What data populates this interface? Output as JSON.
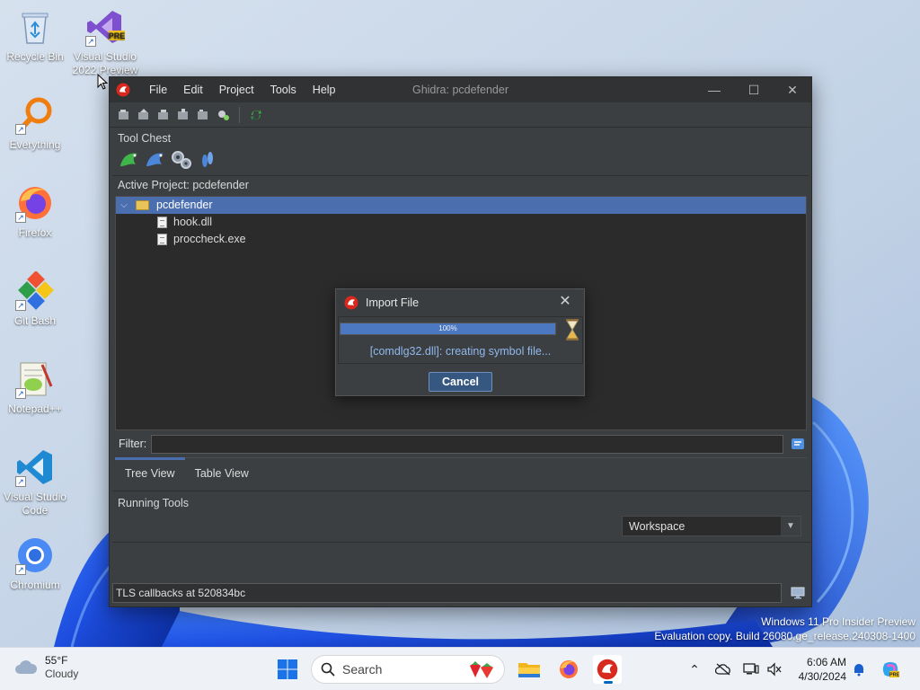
{
  "desktop": {
    "icons": [
      {
        "label": "Recycle Bin"
      },
      {
        "label": "Visual Studio 2022 Preview",
        "badge": "PRE"
      },
      {
        "label": "Everything"
      },
      {
        "label": "Firefox"
      },
      {
        "label": "Git Bash"
      },
      {
        "label": "Notepad++"
      },
      {
        "label": "Visual Studio Code"
      },
      {
        "label": "Chromium"
      }
    ],
    "watermark": {
      "line1": "Windows 11 Pro Insider Preview",
      "line2": "Evaluation copy. Build 26080.ge_release.240308-1400"
    }
  },
  "ghidra": {
    "title": "Ghidra: pcdefender",
    "menu": [
      "File",
      "Edit",
      "Project",
      "Tools",
      "Help"
    ],
    "window_controls": {
      "minimize": "—",
      "maximize": "☐",
      "close": "✕"
    },
    "tool_chest_label": "Tool Chest",
    "active_project_label": "Active Project: pcdefender",
    "tree": {
      "root": "pcdefender",
      "children": [
        "hook.dll",
        "proccheck.exe"
      ]
    },
    "filter_label": "Filter:",
    "filter_value": "",
    "tabs": [
      "Tree View",
      "Table View"
    ],
    "running_tools_label": "Running Tools",
    "workspace_value": "Workspace",
    "status_text": "TLS callbacks at 520834bc"
  },
  "import_dialog": {
    "title": "Import File",
    "progress_label": "100%",
    "progress": 1.0,
    "message": "[comdlg32.dll]: creating symbol file...",
    "cancel_label": "Cancel"
  },
  "taskbar": {
    "weather_temp": "55°F",
    "weather_desc": "Cloudy",
    "search_label": "Search",
    "clock_time": "6:06 AM",
    "clock_date": "4/30/2024"
  },
  "colors": {
    "ghidra_bg": "#3c3f41",
    "selection": "#4b6eaf",
    "progress_fill": "#4b78c0",
    "status_message": "#8fb8ee",
    "taskbar_bg": "#eef1f6"
  }
}
